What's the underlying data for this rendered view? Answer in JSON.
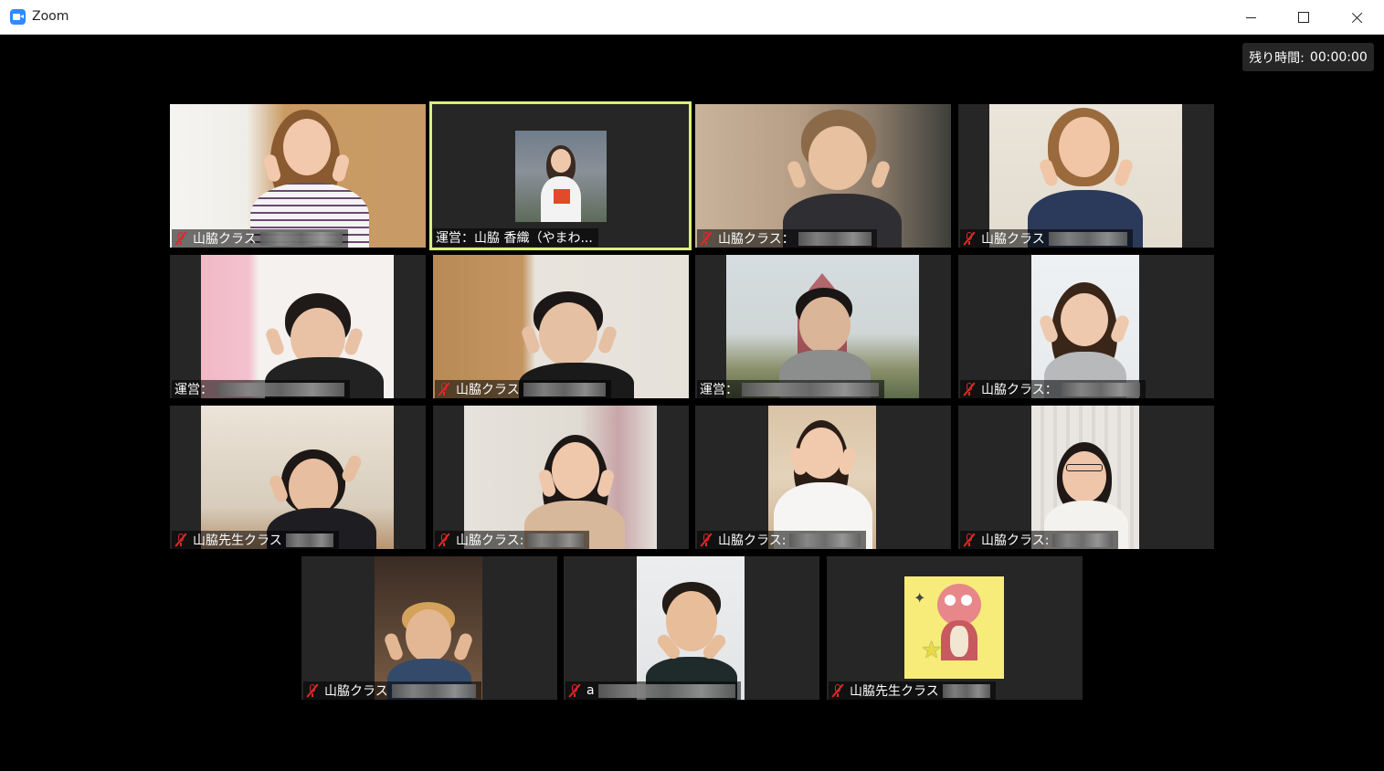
{
  "window": {
    "title": "Zoom",
    "icon": "zoom-camera-icon"
  },
  "timer": {
    "label": "残り時間:",
    "value": "00:00:00"
  },
  "colors": {
    "active_speaker": "#d9f07a",
    "mute": "#e02828",
    "tile_bg": "#262626",
    "brand": "#2D8CFF"
  },
  "participants": [
    {
      "name": "山脇クラス",
      "muted": true
    },
    {
      "name": "運営：山脇 香織（やまわ...",
      "muted": false,
      "active_speaker": true
    },
    {
      "name": "山脇クラス：",
      "muted": true
    },
    {
      "name": "山脇クラス",
      "muted": true
    },
    {
      "name": "運営：",
      "muted": false
    },
    {
      "name": "山脇クラス",
      "muted": true
    },
    {
      "name": "運営：",
      "muted": false
    },
    {
      "name": "山脇クラス：",
      "muted": true
    },
    {
      "name": "山脇先生クラス",
      "muted": true
    },
    {
      "name": "山脇クラス:",
      "muted": true
    },
    {
      "name": "山脇クラス:",
      "muted": true
    },
    {
      "name": "山脇クラス:",
      "muted": true
    },
    {
      "name": "山脇クラス",
      "muted": true
    },
    {
      "name": "a",
      "muted": true
    },
    {
      "name": "山脇先生クラス",
      "muted": true
    }
  ]
}
